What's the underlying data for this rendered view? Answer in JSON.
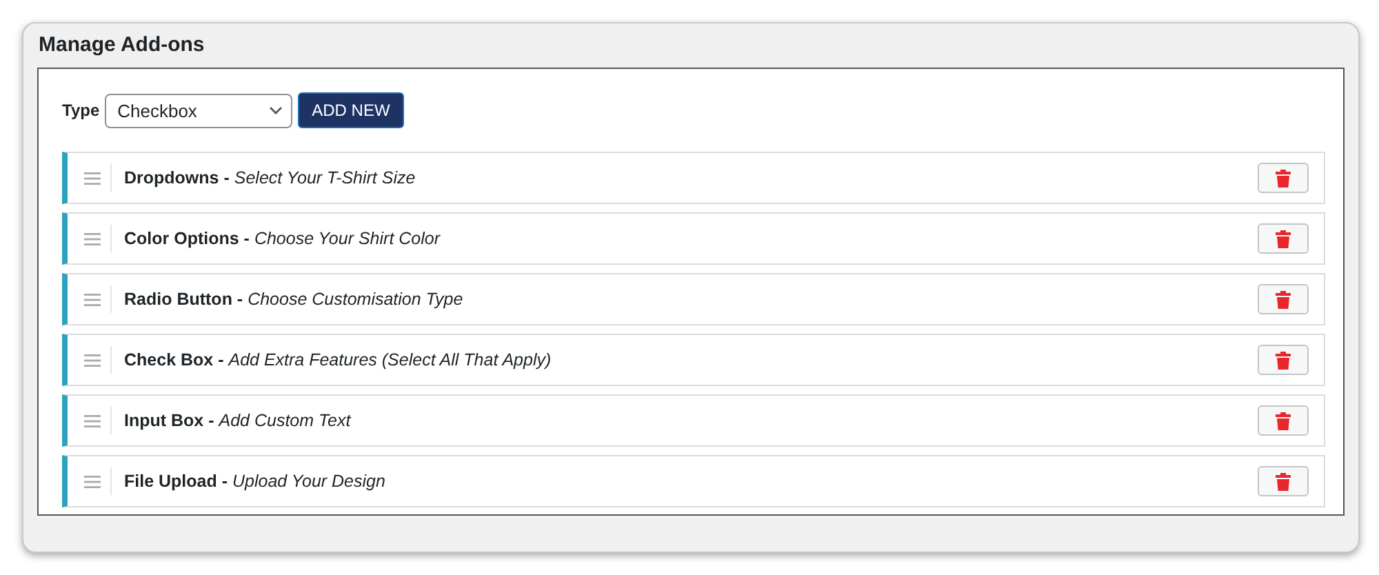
{
  "panel": {
    "title": "Manage Add-ons"
  },
  "toolbar": {
    "type_label": "Type",
    "type_value": "Checkbox",
    "add_button": "ADD NEW"
  },
  "addons": [
    {
      "text": "**Dropdowns -** *Select Your T-Shirt Size*"
    },
    {
      "text": "**Color Options -** *Choose Your Shirt Color*"
    },
    {
      "text": "**Radio Button -** *Choose Customisation Type*"
    },
    {
      "text": "**Check Box -** *Add Extra Features (Select All That Apply)*"
    },
    {
      "text": "**Input Box -** *Add Custom Text*"
    },
    {
      "text": "**File Upload -** *Upload Your Design*"
    }
  ]
}
